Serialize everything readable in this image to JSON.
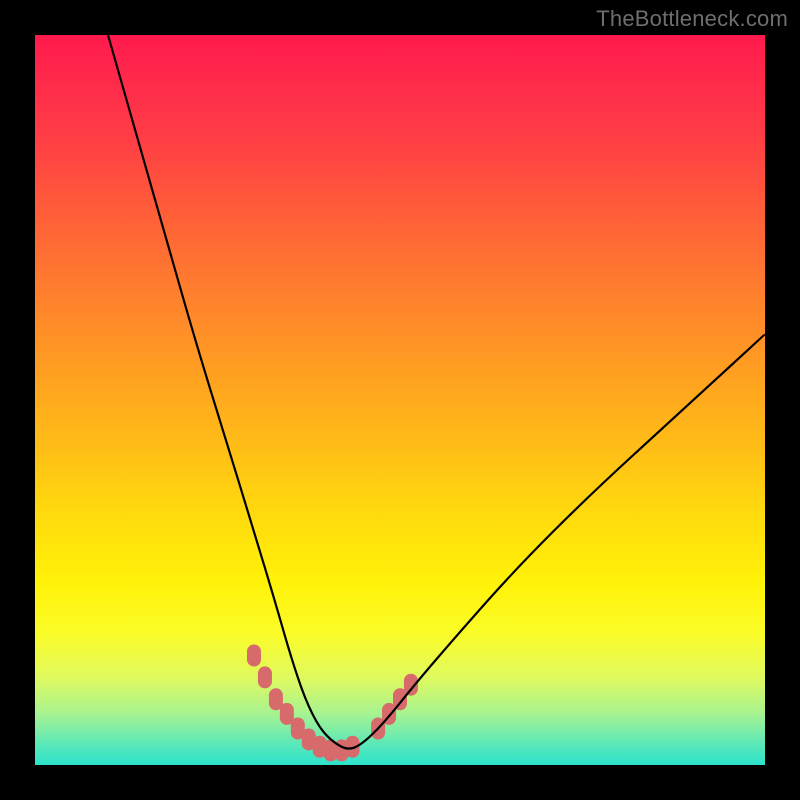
{
  "watermark": "TheBottleneck.com",
  "chart_data": {
    "type": "line",
    "title": "",
    "xlabel": "",
    "ylabel": "",
    "xlim": [
      0,
      100
    ],
    "ylim": [
      0,
      100
    ],
    "series": [
      {
        "name": "black-curve",
        "x": [
          10,
          14,
          18,
          22,
          26,
          30,
          33,
          35,
          37,
          39,
          41,
          43,
          45,
          48,
          52,
          58,
          66,
          76,
          88,
          100
        ],
        "y": [
          100,
          86,
          72,
          58,
          45,
          32,
          22,
          15,
          9,
          5,
          3,
          2,
          3,
          6,
          11,
          18,
          27,
          37,
          48,
          59
        ]
      },
      {
        "name": "salmon-marks-left",
        "x": [
          30,
          31.5,
          33,
          34.5,
          36,
          37.5,
          39,
          40.5,
          42,
          43.5
        ],
        "y": [
          15,
          12,
          9,
          7,
          5,
          3.5,
          2.5,
          2,
          2,
          2.5
        ]
      },
      {
        "name": "salmon-marks-right",
        "x": [
          47,
          48.5,
          50,
          51.5
        ],
        "y": [
          5,
          7,
          9,
          11
        ]
      }
    ],
    "colors": {
      "curve": "#000000",
      "marks": "#d76a6a",
      "gradient_top": "#ff1a4d",
      "gradient_mid": "#ffd80e",
      "gradient_bottom": "#2de3cc"
    }
  }
}
